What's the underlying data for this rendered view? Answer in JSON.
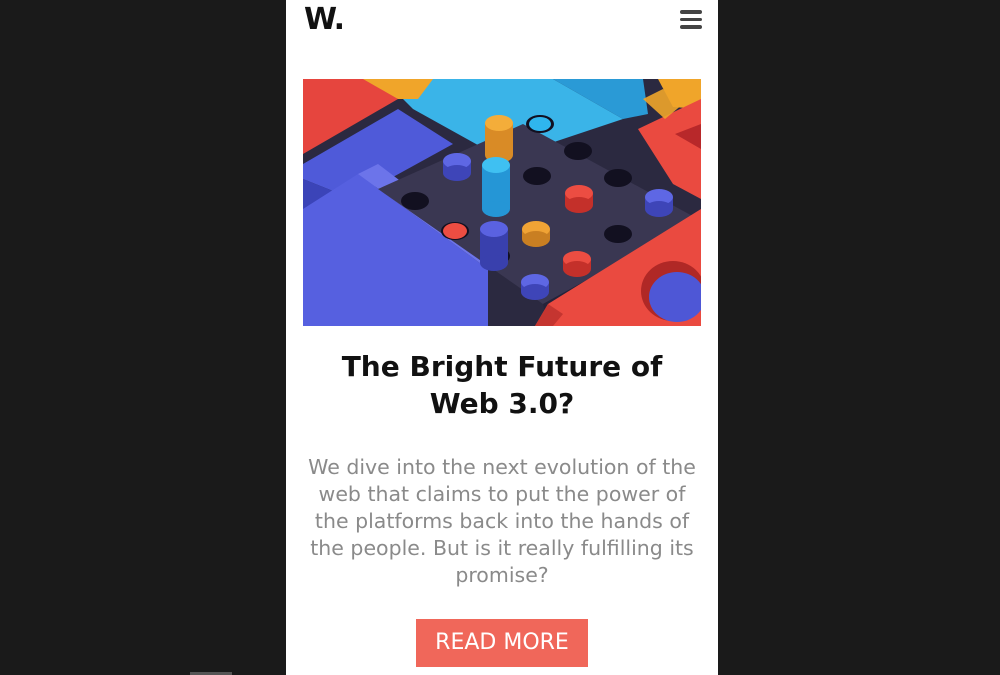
{
  "header": {
    "logo_text": "W.",
    "menu_icon": "hamburger-menu-icon"
  },
  "article": {
    "image_subject": "colorful 3D toy blocks peg board",
    "title": "The Bright Future of Web 3.0?",
    "excerpt": "We dive into the next evolution of the web that claims to put the power of the platforms back into the hands of the people. But is it really fulfilling its promise?",
    "cta_label": "READ MORE"
  },
  "colors": {
    "page_background": "#1a1a1a",
    "card_background": "#ffffff",
    "accent": "#f0675a",
    "title_text": "#111111",
    "body_text": "#8a8a8a"
  }
}
